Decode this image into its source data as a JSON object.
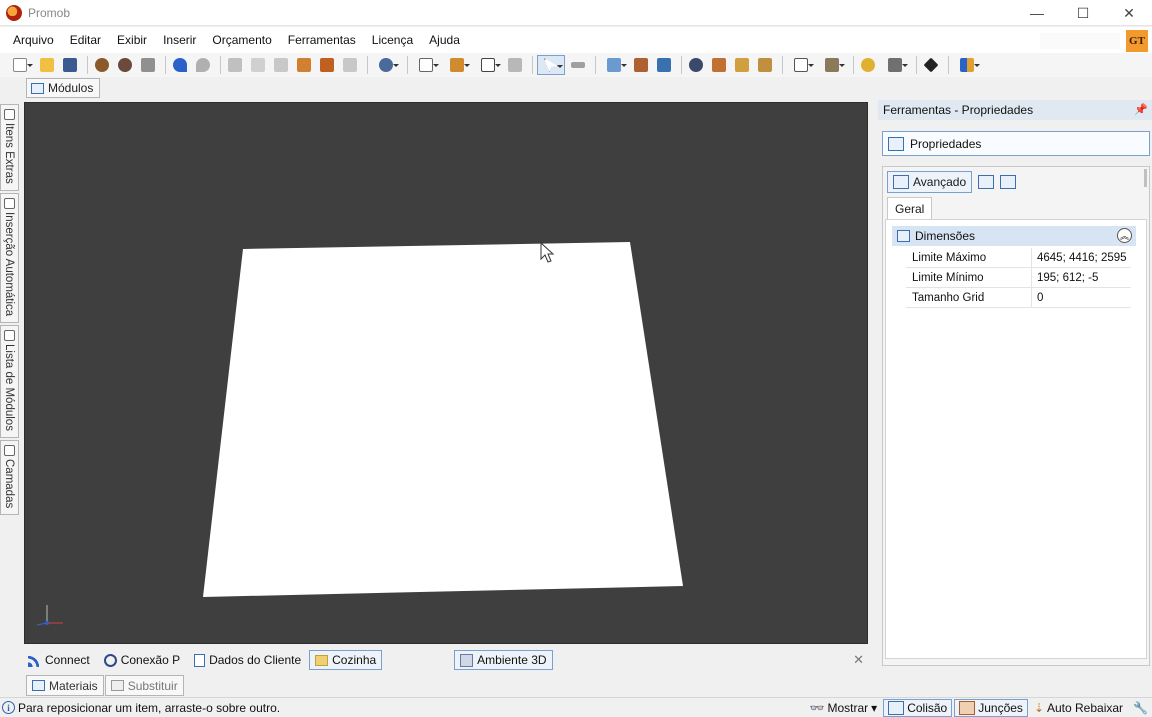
{
  "window": {
    "title": "Promob",
    "minimize_glyph": "—",
    "maximize_glyph": "☐",
    "close_glyph": "✕"
  },
  "menu": {
    "items": [
      "Arquivo",
      "Editar",
      "Exibir",
      "Inserir",
      "Orçamento",
      "Ferramentas",
      "Licença",
      "Ajuda"
    ],
    "badge": "GT"
  },
  "toolbar": {
    "icons": [
      "new-icon",
      "open-folder-icon",
      "save-icon",
      "render-icon",
      "render-alt-icon",
      "print-icon",
      "undo-icon",
      "redo-icon",
      "cut-icon",
      "copy-icon",
      "paste-icon",
      "hammer-icon",
      "paint-roller-icon",
      "delete-icon",
      "money-icon",
      "arrange-icon",
      "stack-icon",
      "shape-icon",
      "wall-icon",
      "select-pointer-icon",
      "measure-icon",
      "layers-icon",
      "elevation-icon",
      "view-3d-icon",
      "eye-icon",
      "rotate-icon",
      "move-left-icon",
      "move-right-icon",
      "frame-icon",
      "cube-icon",
      "light-icon",
      "camera-icon",
      "diamond-icon",
      "palette-icon"
    ]
  },
  "tabs": {
    "modulos": "Módulos"
  },
  "left_tabs": [
    "Itens Extras",
    "Inserção Automática",
    "Lista de Módulos",
    "Camadas"
  ],
  "viewport": {
    "background": "#3f3f3f",
    "floor_color": "#ffffff"
  },
  "doc_tabs": {
    "items": [
      {
        "label": "Connect",
        "icon": "rss-icon",
        "selected": false
      },
      {
        "label": "Conexão P",
        "icon": "promob-p-icon",
        "selected": false
      },
      {
        "label": "Dados do Cliente",
        "icon": "document-icon",
        "selected": false
      },
      {
        "label": "Cozinha",
        "icon": "folder-icon",
        "selected": true
      },
      {
        "label": "Ambiente 3D",
        "icon": "environment-icon",
        "selected": true
      }
    ],
    "close_glyph": "✕"
  },
  "lower_tabs": {
    "materiais": "Materiais",
    "substituir": "Substituir"
  },
  "status": {
    "message": "Para reposicionar um item, arraste-o sobre outro.",
    "mostrar": "Mostrar",
    "colisao": "Colisão",
    "juncoes": "Junções",
    "auto_rebaixar": "Auto Rebaixar"
  },
  "panel": {
    "header": "Ferramentas - Propriedades",
    "properties_button": "Propriedades",
    "advanced_button": "Avançado",
    "tab_geral": "Geral",
    "group": "Dimensões",
    "rows": [
      {
        "name": "Limite Máximo",
        "value": "4645; 4416; 2595"
      },
      {
        "name": "Limite Mínimo",
        "value": "195; 612; -5"
      },
      {
        "name": "Tamanho Grid",
        "value": "0"
      }
    ]
  },
  "colors": {
    "accent": "#3a6fb0",
    "selection_border": "#7aa0d0",
    "group_header": "#d6e4f4",
    "badge": "#f29a2e"
  }
}
